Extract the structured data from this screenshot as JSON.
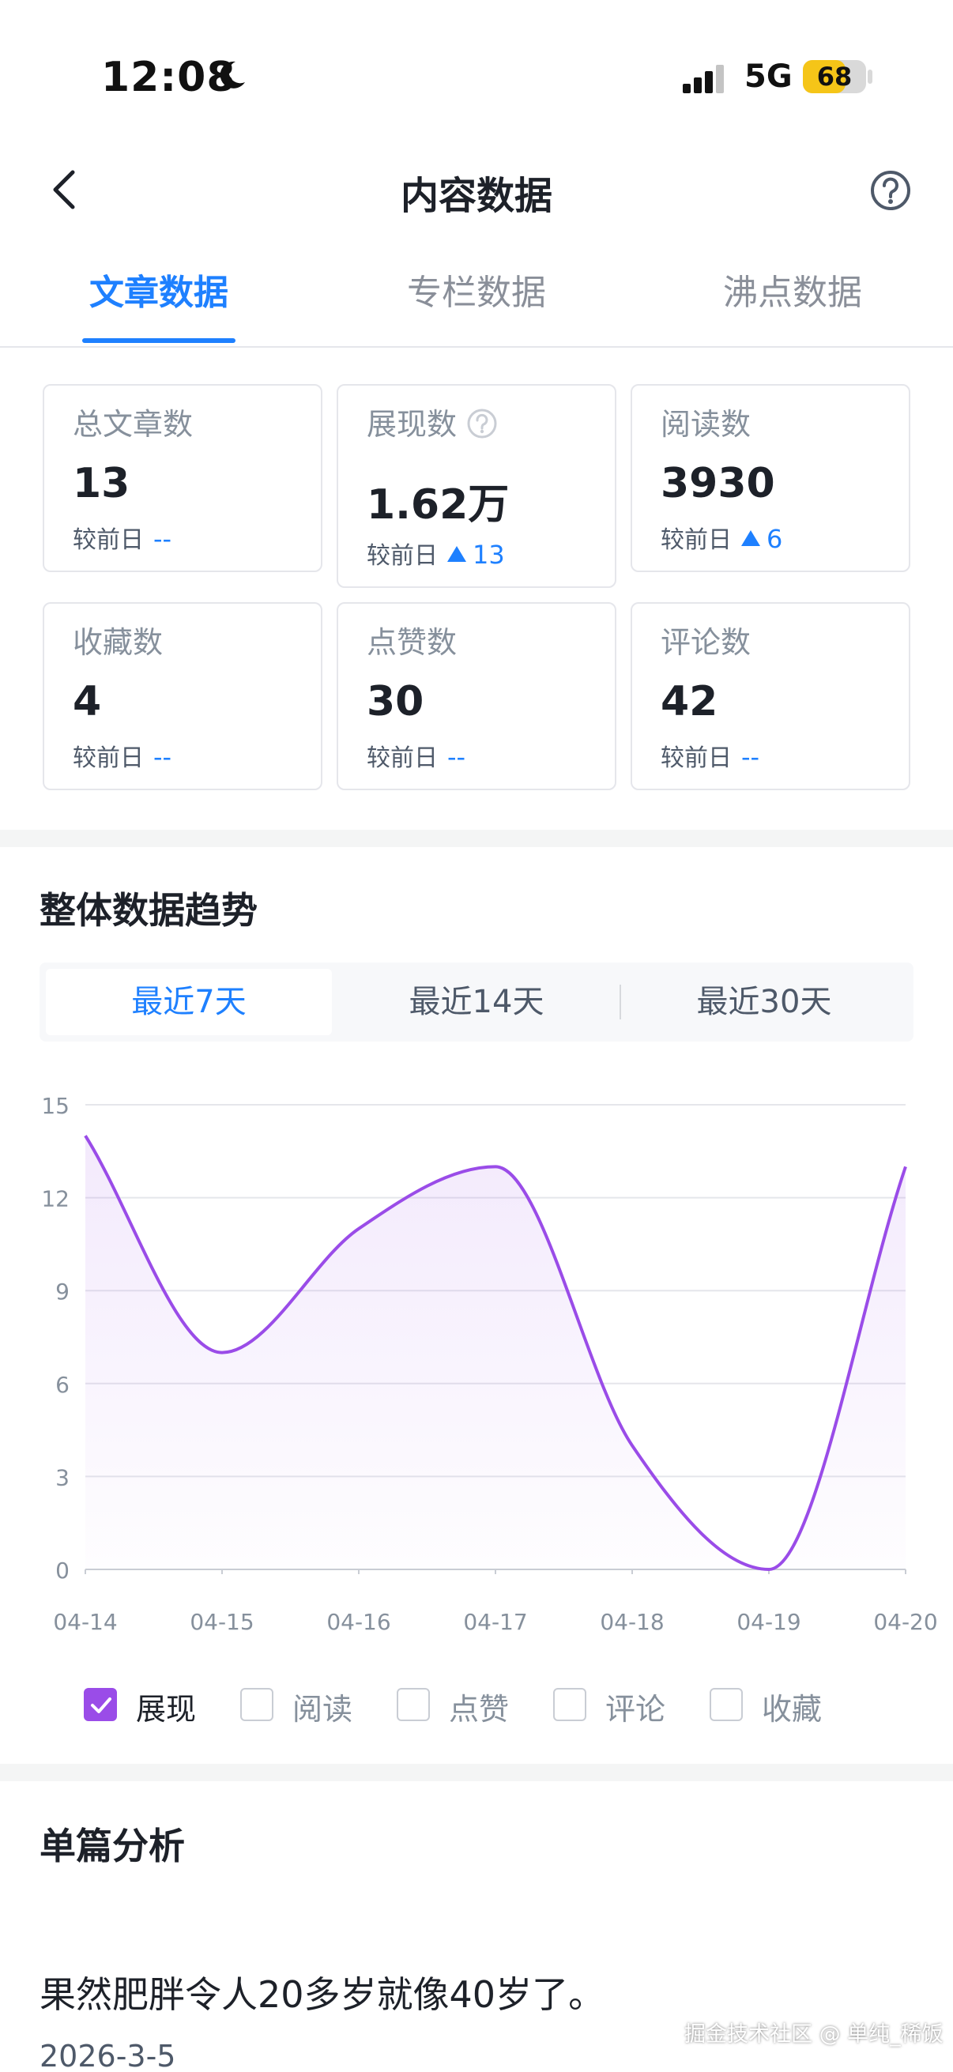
{
  "status_bar": {
    "time": "12:08",
    "network": "5G",
    "battery": 68,
    "battery_text": "68",
    "icons": [
      "moon-icon",
      "signal-icon"
    ]
  },
  "nav": {
    "title": "内容数据",
    "back_icon": "chevron-left-icon",
    "help_icon": "question-circle-icon"
  },
  "tabs": [
    {
      "label": "文章数据",
      "active": true
    },
    {
      "label": "专栏数据",
      "active": false
    },
    {
      "label": "沸点数据",
      "active": false
    }
  ],
  "stats": {
    "compare_label": "较前日",
    "cards": [
      {
        "label": "总文章数",
        "value": "13",
        "delta": "--",
        "trend": "none"
      },
      {
        "label": "展现数",
        "value": "1.62万",
        "delta": "13",
        "trend": "up",
        "has_help": true
      },
      {
        "label": "阅读数",
        "value": "3930",
        "delta": "6",
        "trend": "up"
      },
      {
        "label": "收藏数",
        "value": "4",
        "delta": "--",
        "trend": "none"
      },
      {
        "label": "点赞数",
        "value": "30",
        "delta": "--",
        "trend": "none"
      },
      {
        "label": "评论数",
        "value": "42",
        "delta": "--",
        "trend": "none"
      }
    ]
  },
  "trend": {
    "title": "整体数据趋势",
    "ranges": [
      {
        "label": "最近7天",
        "active": true
      },
      {
        "label": "最近14天",
        "active": false
      },
      {
        "label": "最近30天",
        "active": false
      }
    ],
    "legend": [
      {
        "label": "展现",
        "checked": true
      },
      {
        "label": "阅读",
        "checked": false
      },
      {
        "label": "点赞",
        "checked": false
      },
      {
        "label": "评论",
        "checked": false
      },
      {
        "label": "收藏",
        "checked": false
      }
    ]
  },
  "chart_data": {
    "type": "line",
    "smooth": true,
    "x": [
      "04-14",
      "04-15",
      "04-16",
      "04-17",
      "04-18",
      "04-19",
      "04-20"
    ],
    "series": [
      {
        "name": "展现",
        "values": [
          14,
          7,
          11,
          13,
          4,
          0,
          13
        ],
        "color": "#9a4ce8"
      }
    ],
    "ylim": [
      0,
      15
    ],
    "yticks": [
      0,
      3,
      6,
      9,
      12,
      15
    ],
    "grid": true,
    "area_fill": true
  },
  "single_analysis": {
    "title": "单篇分析",
    "article_title": "果然肥胖令人20多岁就像40岁了。",
    "article_date": "2026-3-5"
  },
  "watermark": "掘金技术社区 @ 单纯_稀饭",
  "colors": {
    "accent": "#1e80ff",
    "series": "#9a4ce8",
    "battery": "#f5c518"
  }
}
